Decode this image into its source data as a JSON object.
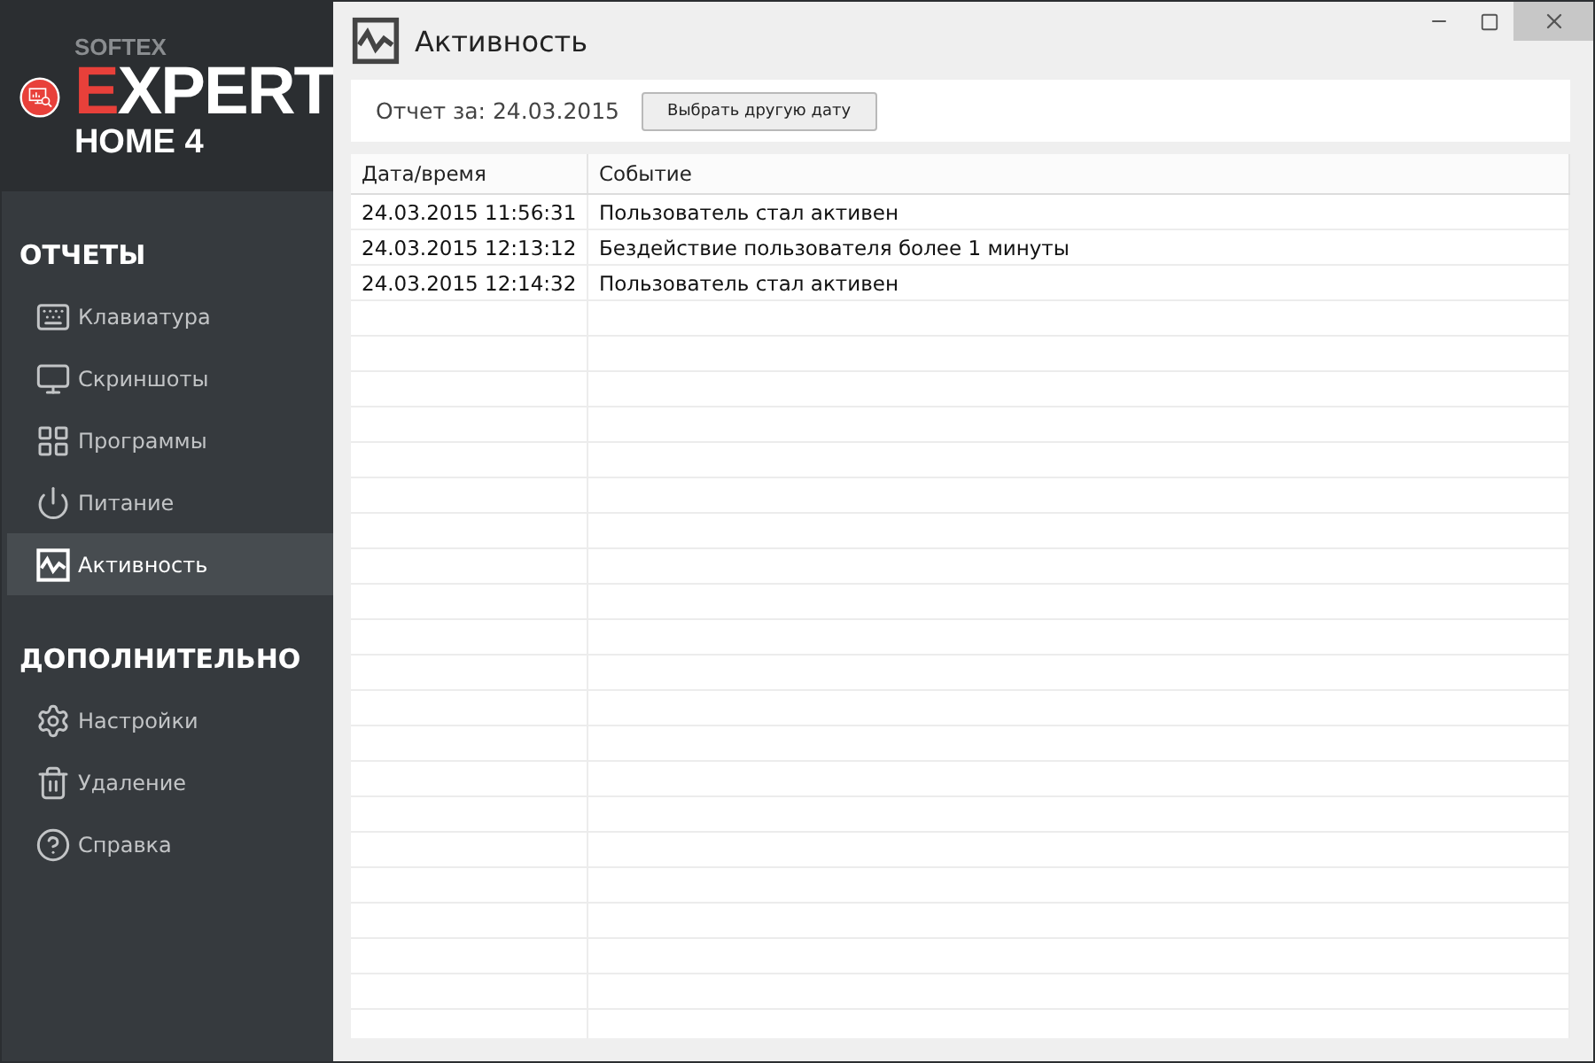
{
  "logo": {
    "brand": "SOFTEX",
    "name": "EXPERT",
    "edition": "HOME 4"
  },
  "sidebar": {
    "sections": [
      {
        "title": "ОТЧЕТЫ",
        "items": [
          {
            "label": "Клавиатура",
            "selected": false
          },
          {
            "label": "Скриншоты",
            "selected": false
          },
          {
            "label": "Программы",
            "selected": false
          },
          {
            "label": "Питание",
            "selected": false
          },
          {
            "label": "Активность",
            "selected": true
          }
        ]
      },
      {
        "title": "ДОПОЛНИТЕЛЬНО",
        "items": [
          {
            "label": "Настройки",
            "selected": false
          },
          {
            "label": "Удаление",
            "selected": false
          },
          {
            "label": "Справка",
            "selected": false
          }
        ]
      }
    ]
  },
  "window": {
    "title": "Активность"
  },
  "toolbar": {
    "report_label": "Отчет за: 24.03.2015",
    "button": "Выбрать другую дату"
  },
  "table": {
    "columns": [
      "Дата/время",
      "Событие"
    ],
    "rows": [
      [
        "24.03.2015 11:56:31",
        "Пользователь стал активен"
      ],
      [
        "24.03.2015 12:13:12",
        "Бездействие пользователя более 1 минуты"
      ],
      [
        "24.03.2015 12:14:32",
        "Пользователь стал активен"
      ]
    ]
  }
}
